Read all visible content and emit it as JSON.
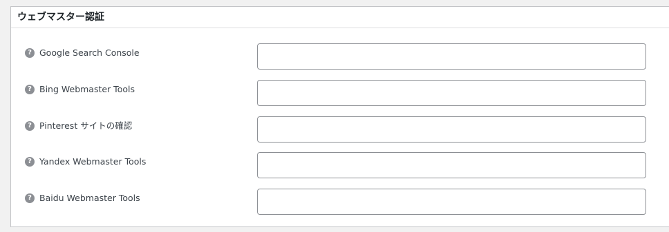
{
  "section": {
    "title": "ウェブマスター認証"
  },
  "rows": [
    {
      "label": "Google Search Console",
      "value": ""
    },
    {
      "label": "Bing Webmaster Tools",
      "value": ""
    },
    {
      "label": "Pinterest サイトの確認",
      "value": ""
    },
    {
      "label": "Yandex Webmaster Tools",
      "value": ""
    },
    {
      "label": "Baidu Webmaster Tools",
      "value": ""
    }
  ],
  "help_icon_glyph": "?"
}
